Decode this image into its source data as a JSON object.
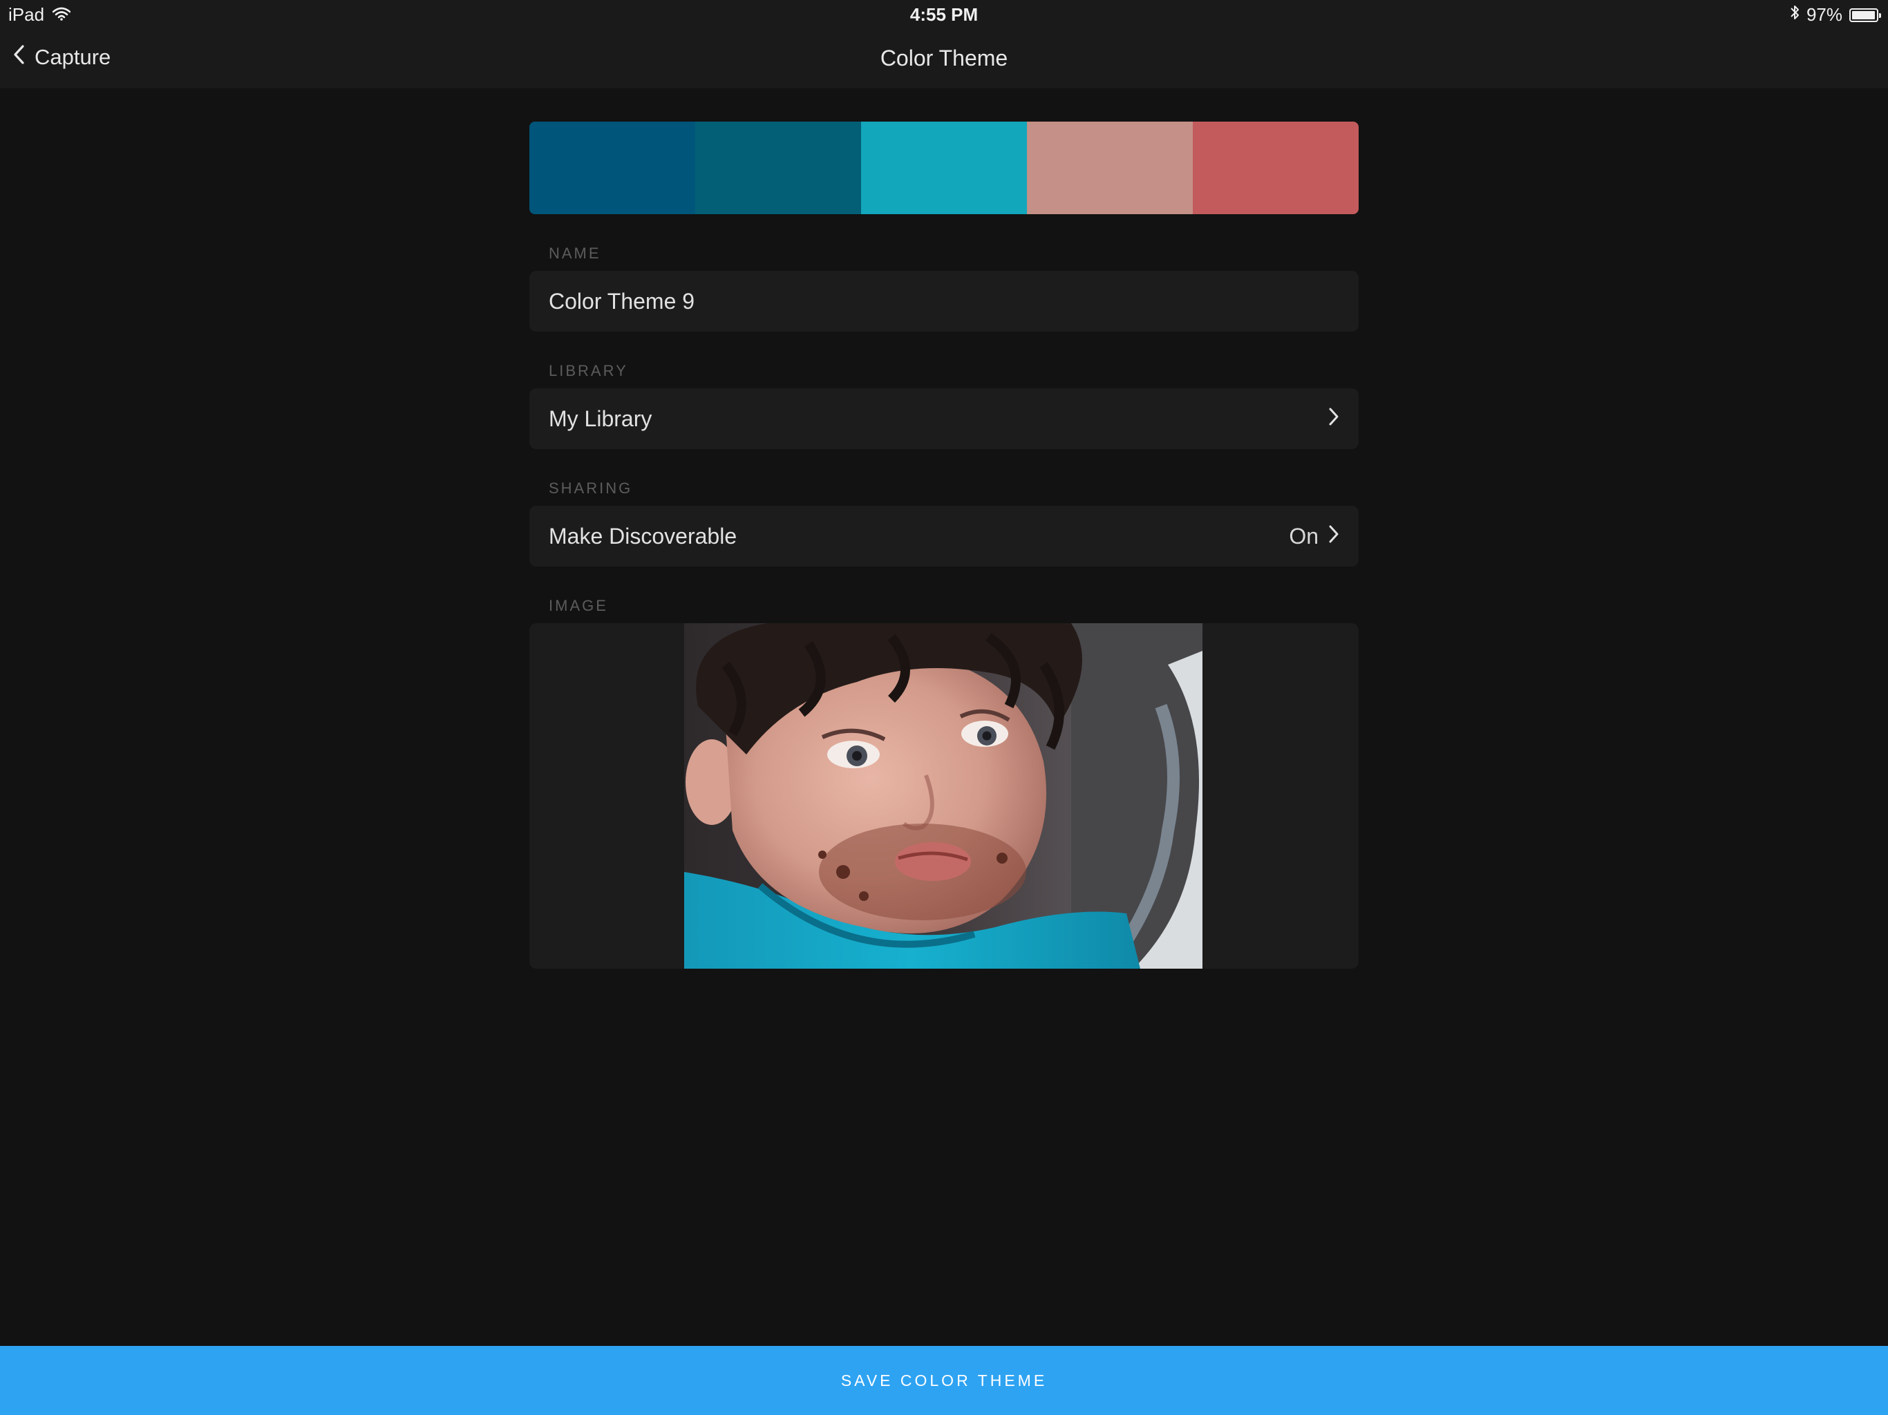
{
  "status_bar": {
    "device": "iPad",
    "time": "4:55 PM",
    "battery": "97%",
    "battery_level": 0.97
  },
  "nav": {
    "back_label": "Capture",
    "title": "Color Theme"
  },
  "palette": {
    "colors": [
      "#00557a",
      "#035f76",
      "#13a7bc",
      "#c49087",
      "#c35b5d"
    ]
  },
  "form": {
    "name_label": "NAME",
    "name_value": "Color Theme 9",
    "library_label": "LIBRARY",
    "library_value": "My Library",
    "sharing_label": "SHARING",
    "sharing_item": "Make Discoverable",
    "sharing_value": "On",
    "image_label": "IMAGE"
  },
  "actions": {
    "save_label": "SAVE COLOR THEME"
  },
  "colors": {
    "accent": "#2ea3f2",
    "background": "#121212",
    "panel": "#1c1c1c"
  },
  "icons": {
    "back": "chevron-left-icon",
    "disclosure": "chevron-right-icon",
    "wifi": "wifi-icon",
    "bluetooth": "bluetooth-icon",
    "battery": "battery-icon"
  }
}
